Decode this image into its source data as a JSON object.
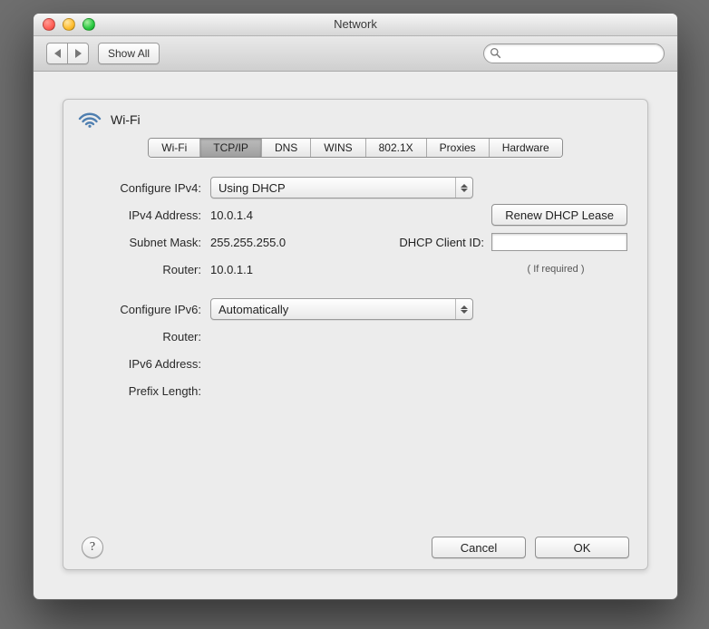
{
  "window": {
    "title": "Network"
  },
  "toolbar": {
    "show_all": "Show All",
    "search_placeholder": ""
  },
  "sheet": {
    "service_name": "Wi-Fi",
    "tabs": [
      "Wi-Fi",
      "TCP/IP",
      "DNS",
      "WINS",
      "802.1X",
      "Proxies",
      "Hardware"
    ],
    "active_tab_index": 1,
    "fields": {
      "configure_ipv4_label": "Configure IPv4:",
      "configure_ipv4_value": "Using DHCP",
      "ipv4_address_label": "IPv4 Address:",
      "ipv4_address_value": "10.0.1.4",
      "subnet_mask_label": "Subnet Mask:",
      "subnet_mask_value": "255.255.255.0",
      "router_label": "Router:",
      "router_value": "10.0.1.1",
      "renew_dhcp_label": "Renew DHCP Lease",
      "dhcp_client_id_label": "DHCP Client ID:",
      "dhcp_client_id_value": "",
      "dhcp_client_id_note": "( If required )",
      "configure_ipv6_label": "Configure IPv6:",
      "configure_ipv6_value": "Automatically",
      "router6_label": "Router:",
      "router6_value": "",
      "ipv6_address_label": "IPv6 Address:",
      "ipv6_address_value": "",
      "prefix_length_label": "Prefix Length:",
      "prefix_length_value": ""
    },
    "buttons": {
      "cancel": "Cancel",
      "ok": "OK",
      "help": "?"
    }
  }
}
